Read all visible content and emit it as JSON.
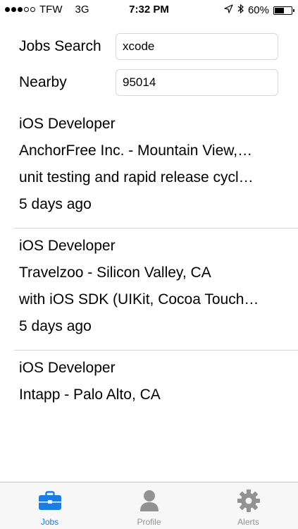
{
  "status_bar": {
    "carrier": "TFW",
    "network": "3G",
    "time": "7:32 PM",
    "battery_percent": "60%",
    "battery_level": 0.6,
    "signal_bars_filled": 3,
    "signal_bars_total": 5,
    "icons": [
      "location-arrow-icon",
      "bluetooth-icon",
      "battery-icon"
    ]
  },
  "search": {
    "keyword_label": "Jobs Search",
    "keyword_value": "xcode",
    "location_label": "Nearby",
    "location_value": "95014"
  },
  "jobs": [
    {
      "title": "iOS Developer",
      "company_location": "AnchorFree Inc. - Mountain View,…",
      "snippet": "unit testing and rapid release cycl…",
      "posted": "5 days ago"
    },
    {
      "title": "iOS Developer",
      "company_location": "Travelzoo - Silicon Valley, CA",
      "snippet": "with iOS SDK (UIKit, Cocoa Touch…",
      "posted": "5 days ago"
    },
    {
      "title": "iOS Developer",
      "company_location": "Intapp - Palo Alto, CA",
      "snippet": "",
      "posted": ""
    }
  ],
  "tabs": [
    {
      "label": "Jobs",
      "icon": "briefcase-icon",
      "active": true
    },
    {
      "label": "Profile",
      "icon": "person-icon",
      "active": false
    },
    {
      "label": "Alerts",
      "icon": "gear-icon",
      "active": false
    }
  ],
  "colors": {
    "accent": "#1a7ee0",
    "inactive_tab": "#929292",
    "separator": "#d4d4d4"
  }
}
